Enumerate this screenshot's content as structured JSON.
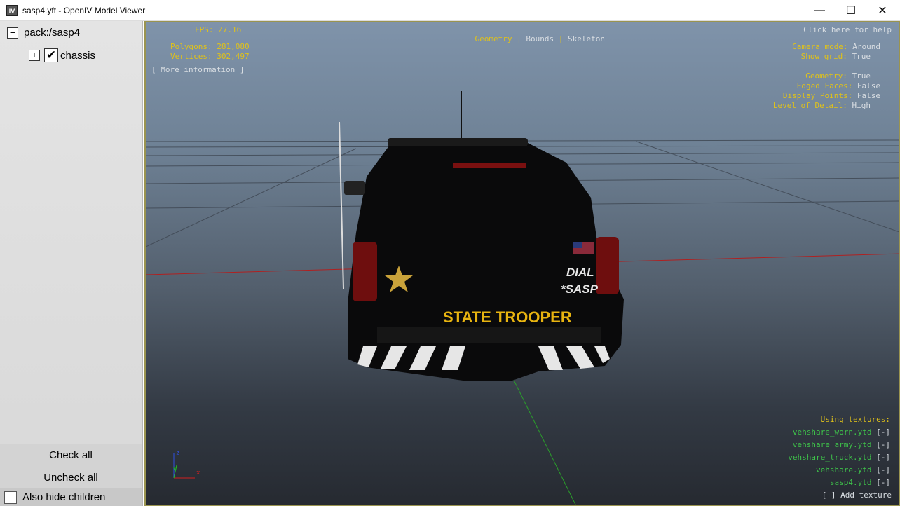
{
  "window": {
    "title": "sasp4.yft - OpenIV Model Viewer",
    "icon_text": "IV",
    "minimize": "—",
    "maximize": "☐",
    "close": "✕"
  },
  "tree": {
    "root": "pack:/sasp4",
    "root_toggle": "−",
    "child": "chassis",
    "child_toggle": "+",
    "child_check": "✔"
  },
  "sidebar": {
    "check_all": "Check all",
    "uncheck_all": "Uncheck all",
    "hide_children": "Also hide children"
  },
  "hud": {
    "fps_label": "FPS:",
    "fps": "27.16",
    "polygons_label": "Polygons:",
    "polygons": "281,080",
    "vertices_label": "Vertices:",
    "vertices": "302,497",
    "more_info": "[ More information ]",
    "modes": [
      "Geometry",
      "Bounds",
      "Skeleton"
    ],
    "sep": "|",
    "help": "Click here for help",
    "settings": [
      {
        "label": "Camera mode:",
        "value": "Around"
      },
      {
        "label": "Show grid:",
        "value": "True"
      },
      {
        "label": "Geometry:",
        "value": "True"
      },
      {
        "label": "Edged Faces:",
        "value": "False"
      },
      {
        "label": "Display Points:",
        "value": "False"
      },
      {
        "label": "Level of Detail:",
        "value": "High"
      }
    ],
    "textures_label": "Using textures:",
    "textures": [
      "vehshare_worn.ytd",
      "vehshare_army.ytd",
      "vehshare_truck.ytd",
      "vehshare.ytd",
      "sasp4.ytd"
    ],
    "remove": "[-]",
    "add_texture": "[+] Add texture"
  },
  "model": {
    "rear_text": "STATE TROOPER",
    "side_text_1": "DIAL",
    "side_text_2": "*SASP"
  },
  "axis": {
    "z": "z",
    "y": "y",
    "x": "x"
  }
}
